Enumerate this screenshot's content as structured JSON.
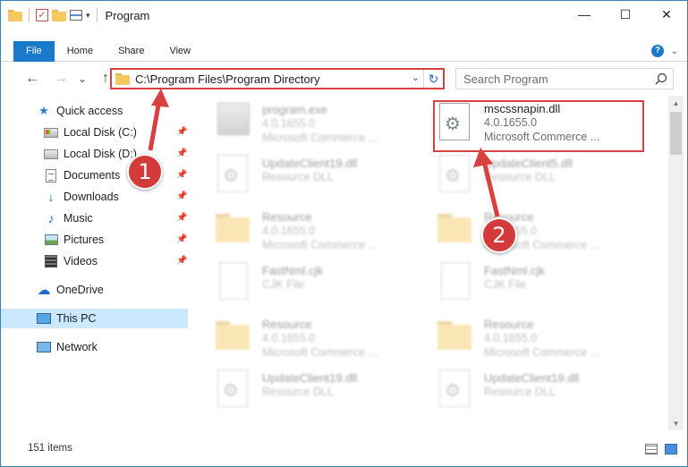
{
  "window": {
    "title": "Program",
    "controls": {
      "minimize": "—",
      "maximize": "☐",
      "close": "✕"
    }
  },
  "ribbon": {
    "tabs": [
      "File",
      "Home",
      "Share",
      "View"
    ]
  },
  "navigation": {
    "back": "←",
    "forward": "→",
    "recent": "⌄",
    "up": "↑",
    "address": "C:\\Program Files\\Program Directory",
    "refresh": "↻",
    "search_placeholder": "Search Program"
  },
  "sidebar": {
    "quick_access": "Quick access",
    "items": [
      {
        "label": "Local Disk (C:)",
        "pinned": true
      },
      {
        "label": "Local Disk (D:)",
        "pinned": true
      },
      {
        "label": "Documents",
        "pinned": true
      },
      {
        "label": "Downloads",
        "pinned": true
      },
      {
        "label": "Music",
        "pinned": true
      },
      {
        "label": "Pictures",
        "pinned": true
      },
      {
        "label": "Videos",
        "pinned": true
      }
    ],
    "onedrive": "OneDrive",
    "this_pc": "This PC",
    "network": "Network",
    "pin_glyph": "📌"
  },
  "files": {
    "highlighted": {
      "name": "mscssnapin.dll",
      "version": "4.0.1655.0",
      "company": "Microsoft Commerce ..."
    },
    "left_column": [
      {
        "name": "program.exe",
        "line2": "4.0.1655.0",
        "line3": "Microsoft Commerce ..."
      },
      {
        "name": "UpdateClient19.dll",
        "line2": "Resource DLL",
        "line3": ""
      },
      {
        "name": "Resource",
        "line2": "4.0.1655.0",
        "line3": "Microsoft Commerce ..."
      },
      {
        "name": "FastNml.cjk",
        "line2": "CJK File",
        "line3": ""
      },
      {
        "name": "Resource",
        "line2": "4.0.1655.0",
        "line3": "Microsoft Commerce ..."
      },
      {
        "name": "UpdateClient19.dll",
        "line2": "Resource DLL",
        "line3": ""
      }
    ],
    "right_column": [
      {
        "name": "UpdateClient5.dll",
        "line2": "Resource DLL",
        "line3": ""
      },
      {
        "name": "Resource",
        "line2": "4.0.1655.0",
        "line3": "Microsoft Commerce ..."
      },
      {
        "name": "FastNml.cjk",
        "line2": "CJK File",
        "line3": ""
      },
      {
        "name": "Resource",
        "line2": "4.0.1655.0",
        "line3": "Microsoft Commerce ..."
      },
      {
        "name": "UpdateClient19.dll",
        "line2": "Resource DLL",
        "line3": ""
      }
    ]
  },
  "callouts": {
    "first": "1",
    "second": "2"
  },
  "status": {
    "item_count": "151 items"
  },
  "colors": {
    "accent": "#1979ca",
    "annotation": "#d94040",
    "selected": "#cce8ff"
  }
}
